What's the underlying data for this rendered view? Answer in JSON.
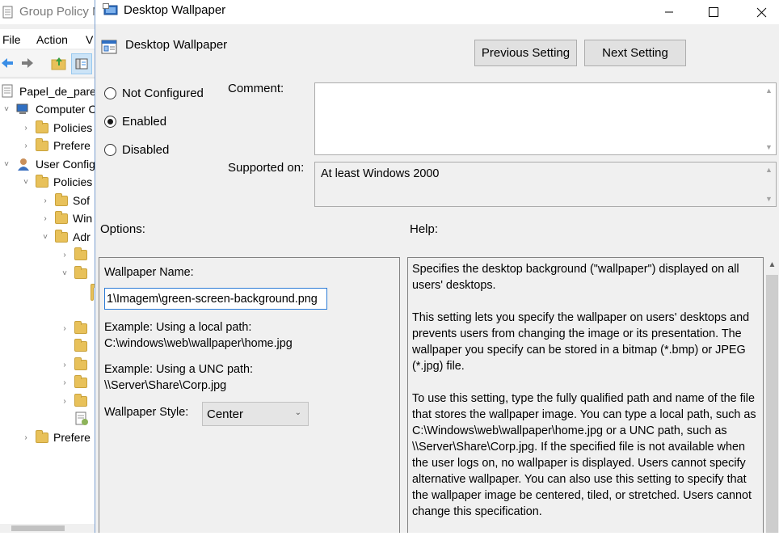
{
  "background_window": {
    "title": "Group Policy M",
    "menu": [
      "File",
      "Action",
      "V"
    ],
    "tree": [
      {
        "label": "Papel_de_pare",
        "chevron": "",
        "type": "doc"
      },
      {
        "label": "Computer C",
        "chevron": "v",
        "type": "computer"
      },
      {
        "label": "Policies",
        "chevron": ">",
        "type": "folder"
      },
      {
        "label": "Prefere",
        "chevron": ">",
        "type": "folder"
      },
      {
        "label": "User Config",
        "chevron": "v",
        "type": "user"
      },
      {
        "label": "Policies",
        "chevron": "v",
        "type": "folder"
      },
      {
        "label": "Sof",
        "chevron": ">",
        "type": "folder"
      },
      {
        "label": "Win",
        "chevron": ">",
        "type": "folder"
      },
      {
        "label": "Adr",
        "chevron": "v",
        "type": "folder"
      },
      {
        "label": "",
        "chevron": ">",
        "type": "folder"
      },
      {
        "label": "",
        "chevron": "v",
        "type": "folder"
      },
      {
        "label": "",
        "chevron": "",
        "type": "folder-small"
      },
      {
        "label": "",
        "chevron": ">",
        "type": "folder"
      },
      {
        "label": "",
        "chevron": "",
        "type": "folder"
      },
      {
        "label": "",
        "chevron": ">",
        "type": "folder"
      },
      {
        "label": "",
        "chevron": ">",
        "type": "folder"
      },
      {
        "label": "",
        "chevron": ">",
        "type": "folder"
      },
      {
        "label": "",
        "chevron": "",
        "type": "policy"
      },
      {
        "label": "Prefere",
        "chevron": ">",
        "type": "folder"
      }
    ]
  },
  "dialog": {
    "title": "Desktop Wallpaper",
    "header": "Desktop Wallpaper",
    "previous_button": "Previous Setting",
    "next_button": "Next Setting",
    "radios": [
      {
        "label": "Not Configured",
        "checked": false
      },
      {
        "label": "Enabled",
        "checked": true
      },
      {
        "label": "Disabled",
        "checked": false
      }
    ],
    "comment_label": "Comment:",
    "comment_value": "",
    "supported_label": "Supported on:",
    "supported_value": "At least Windows 2000",
    "options_label": "Options:",
    "help_label": "Help:",
    "options": {
      "wallpaper_name_label": "Wallpaper Name:",
      "wallpaper_name_value": "1\\Imagem\\green-screen-background.png",
      "example_local_label": "Example: Using a local path:",
      "example_local_value": "C:\\windows\\web\\wallpaper\\home.jpg",
      "example_unc_label": "Example: Using a UNC path:",
      "example_unc_value": "\\\\Server\\Share\\Corp.jpg",
      "wallpaper_style_label": "Wallpaper Style:",
      "wallpaper_style_value": "Center"
    },
    "help_paragraphs": [
      "Specifies the desktop background (\"wallpaper\") displayed on all users' desktops.",
      "This setting lets you specify the wallpaper on users' desktops and prevents users from changing the image or its presentation. The wallpaper you specify can be stored in a bitmap (*.bmp) or JPEG (*.jpg) file.",
      "To use this setting, type the fully qualified path and name of the file that stores the wallpaper image. You can type a local path, such as C:\\Windows\\web\\wallpaper\\home.jpg or a UNC path, such as \\\\Server\\Share\\Corp.jpg. If the specified file is not available when the user logs on, no wallpaper is displayed. Users cannot specify alternative wallpaper. You can also use this setting to specify that the wallpaper image be centered, tiled, or stretched. Users cannot change this specification."
    ]
  },
  "icons": {
    "minimize": "minimize-icon",
    "maximize": "maximize-icon",
    "close": "close-icon"
  }
}
